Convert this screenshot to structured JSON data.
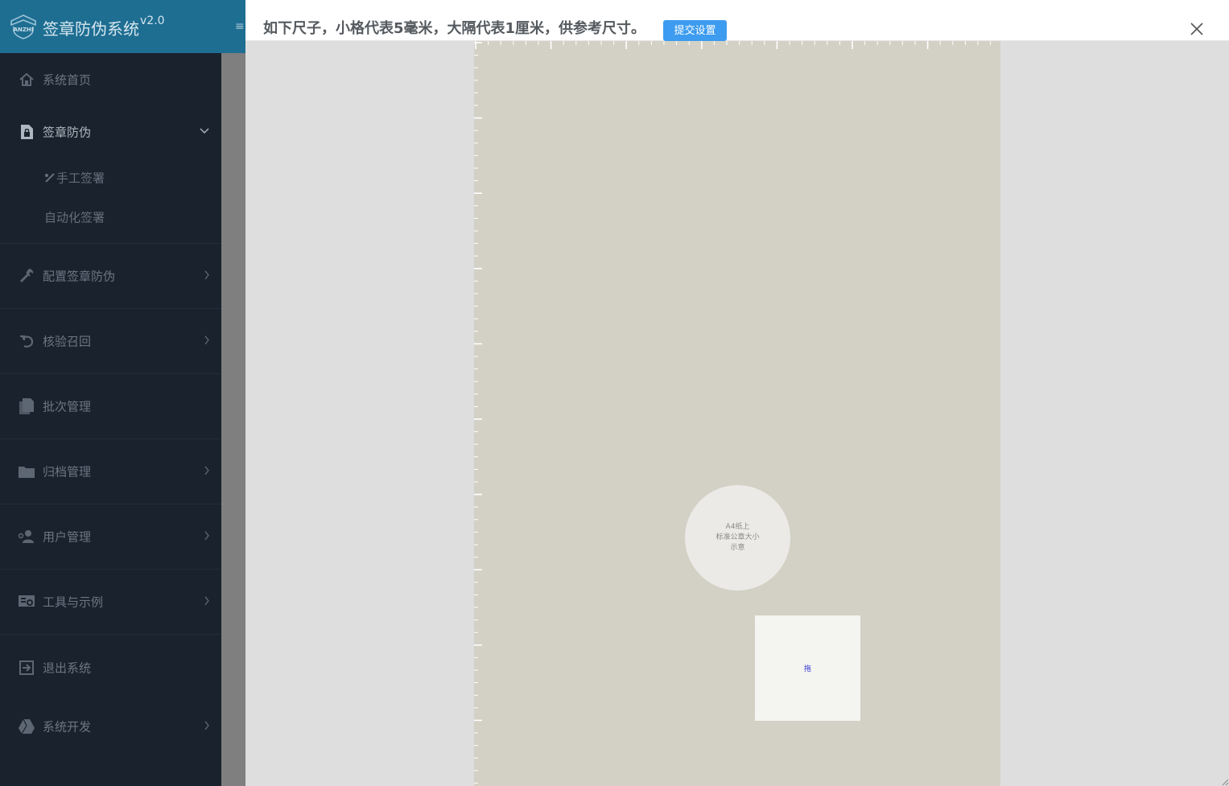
{
  "app": {
    "title": "签章防伪系统",
    "version": "v2.0",
    "logo_text": "ANZHI"
  },
  "sidebar": {
    "items": [
      {
        "label": "系统首页",
        "icon": "home-icon"
      },
      {
        "label": "签章防伪",
        "icon": "file-lock-icon",
        "expanded": true,
        "children": [
          {
            "label": "手工签署",
            "icon": "sign-pen-icon"
          },
          {
            "label": "自动化签署"
          }
        ]
      },
      {
        "label": "配置签章防伪",
        "icon": "wrench-icon"
      },
      {
        "label": "核验召回",
        "icon": "undo-icon"
      },
      {
        "label": "批次管理",
        "icon": "documents-icon"
      },
      {
        "label": "归档管理",
        "icon": "folder-icon"
      },
      {
        "label": "用户管理",
        "icon": "users-icon"
      },
      {
        "label": "工具与示例",
        "icon": "tools-icon"
      },
      {
        "label": "退出系统",
        "icon": "logout-icon"
      },
      {
        "label": "系统开发",
        "icon": "drive-icon"
      }
    ]
  },
  "modal": {
    "title": "如下尺子，小格代表5毫米，大隔代表1厘米，供参考尺寸。",
    "submit_label": "提交设置",
    "seal_sample_text": [
      "A4纸上",
      "标准公章大小",
      "示意"
    ],
    "drag_label": "拖"
  },
  "colors": {
    "brand_header": "#1e6e92",
    "sidebar_bg": "#1a222d",
    "submit_button": "#3d9cf0",
    "paper": "#d3d1c5"
  }
}
